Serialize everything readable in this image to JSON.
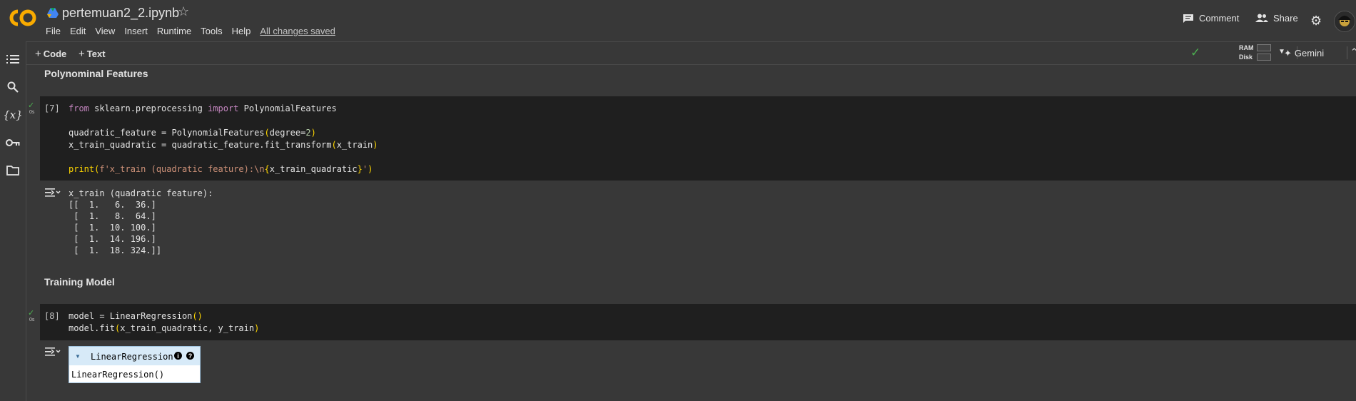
{
  "header": {
    "title": "pertemuan2_2.ipynb",
    "menu": [
      "File",
      "Edit",
      "View",
      "Insert",
      "Runtime",
      "Tools",
      "Help"
    ],
    "saved_status": "All changes saved",
    "comment_label": "Comment",
    "share_label": "Share"
  },
  "toolbar": {
    "code_label": "Code",
    "text_label": "Text",
    "ram_label": "RAM",
    "disk_label": "Disk",
    "gemini_label": "Gemini"
  },
  "sections": {
    "poly_title": "Polynominal Features",
    "training_title": "Training Model"
  },
  "cell7": {
    "exec_count": "[7]",
    "time": "0s",
    "code": [
      "from sklearn.preprocessing import PolynomialFeatures",
      "",
      "quadratic_feature = PolynomialFeatures(degree=2)",
      "x_train_quadratic = quadratic_feature.fit_transform(x_train)",
      "",
      "print(f'x_train (quadratic feature):\\n{x_train_quadratic}')"
    ],
    "output": [
      "x_train (quadratic feature):",
      "[[  1.   6.  36.]",
      " [  1.   8.  64.]",
      " [  1.  10. 100.]",
      " [  1.  14. 196.]",
      " [  1.  18. 324.]]"
    ]
  },
  "cell8": {
    "exec_count": "[8]",
    "time": "0s",
    "code": [
      "model = LinearRegression()",
      "model.fit(x_train_quadratic, y_train)"
    ],
    "estimator_label": "LinearRegression",
    "estimator_repr": "LinearRegression()"
  },
  "colors": {
    "background": "#383838",
    "cell_background": "#1f1f1f",
    "keyword": "#c586c0",
    "bracket": "#ffd700",
    "string": "#ce9178",
    "check": "#4caf50"
  }
}
